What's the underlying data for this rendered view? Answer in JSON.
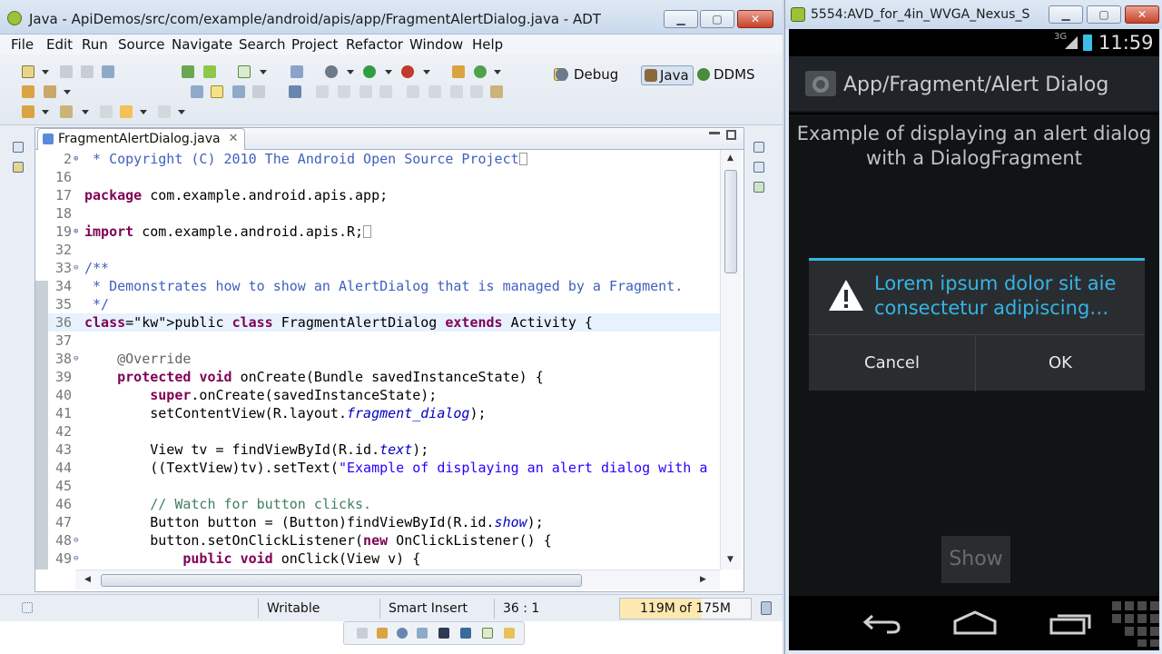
{
  "adt": {
    "title": "Java - ApiDemos/src/com/example/android/apis/app/FragmentAlertDialog.java - ADT",
    "menu": [
      "File",
      "Edit",
      "Run",
      "Source",
      "Navigate",
      "Search",
      "Project",
      "Refactor",
      "Window",
      "Help"
    ],
    "perspectives": {
      "debug": "Debug",
      "java": "Java",
      "ddms": "DDMS"
    },
    "editor_tab": "FragmentAlertDialog.java",
    "lines": [
      {
        "num": "2",
        "code": " * Copyright (C) 2010 The Android Open Source Project"
      },
      {
        "num": "16",
        "code": ""
      },
      {
        "num": "17",
        "code": "package com.example.android.apis.app;"
      },
      {
        "num": "18",
        "code": ""
      },
      {
        "num": "19",
        "code": "import com.example.android.apis.R;"
      },
      {
        "num": "32",
        "code": ""
      },
      {
        "num": "33",
        "code": "/**"
      },
      {
        "num": "34",
        "code": " * Demonstrates how to show an AlertDialog that is managed by a Fragment."
      },
      {
        "num": "35",
        "code": " */"
      },
      {
        "num": "36",
        "code": "public class FragmentAlertDialog extends Activity {"
      },
      {
        "num": "37",
        "code": ""
      },
      {
        "num": "38",
        "code": "    @Override"
      },
      {
        "num": "39",
        "code": "    protected void onCreate(Bundle savedInstanceState) {"
      },
      {
        "num": "40",
        "code": "        super.onCreate(savedInstanceState);"
      },
      {
        "num": "41",
        "code": "        setContentView(R.layout.fragment_dialog);"
      },
      {
        "num": "42",
        "code": ""
      },
      {
        "num": "43",
        "code": "        View tv = findViewById(R.id.text);"
      },
      {
        "num": "44",
        "code": "        ((TextView)tv).setText(\"Example of displaying an alert dialog with a"
      },
      {
        "num": "45",
        "code": ""
      },
      {
        "num": "46",
        "code": "        // Watch for button clicks."
      },
      {
        "num": "47",
        "code": "        Button button = (Button)findViewById(R.id.show);"
      },
      {
        "num": "48",
        "code": "        button.setOnClickListener(new OnClickListener() {"
      },
      {
        "num": "49",
        "code": "            public void onClick(View v) {"
      }
    ],
    "status": {
      "writable": "Writable",
      "insert_mode": "Smart Insert",
      "position": "36 : 1",
      "heap": "119M of 175M"
    }
  },
  "emulator": {
    "title": "5554:AVD_for_4in_WVGA_Nexus_S",
    "network": "3G",
    "clock": "11:59",
    "action_bar_title": "App/Fragment/Alert Dialog",
    "description": "Example of displaying an alert dialog with a DialogFragment",
    "dialog": {
      "title": "Lorem ipsum dolor sit aie consectetur adipiscing…",
      "cancel": "Cancel",
      "ok": "OK"
    },
    "show_button": "Show"
  },
  "colors": {
    "holo_blue": "#33b5e5",
    "keyword": "#7f0055",
    "javadoc": "#3f5fbf"
  }
}
